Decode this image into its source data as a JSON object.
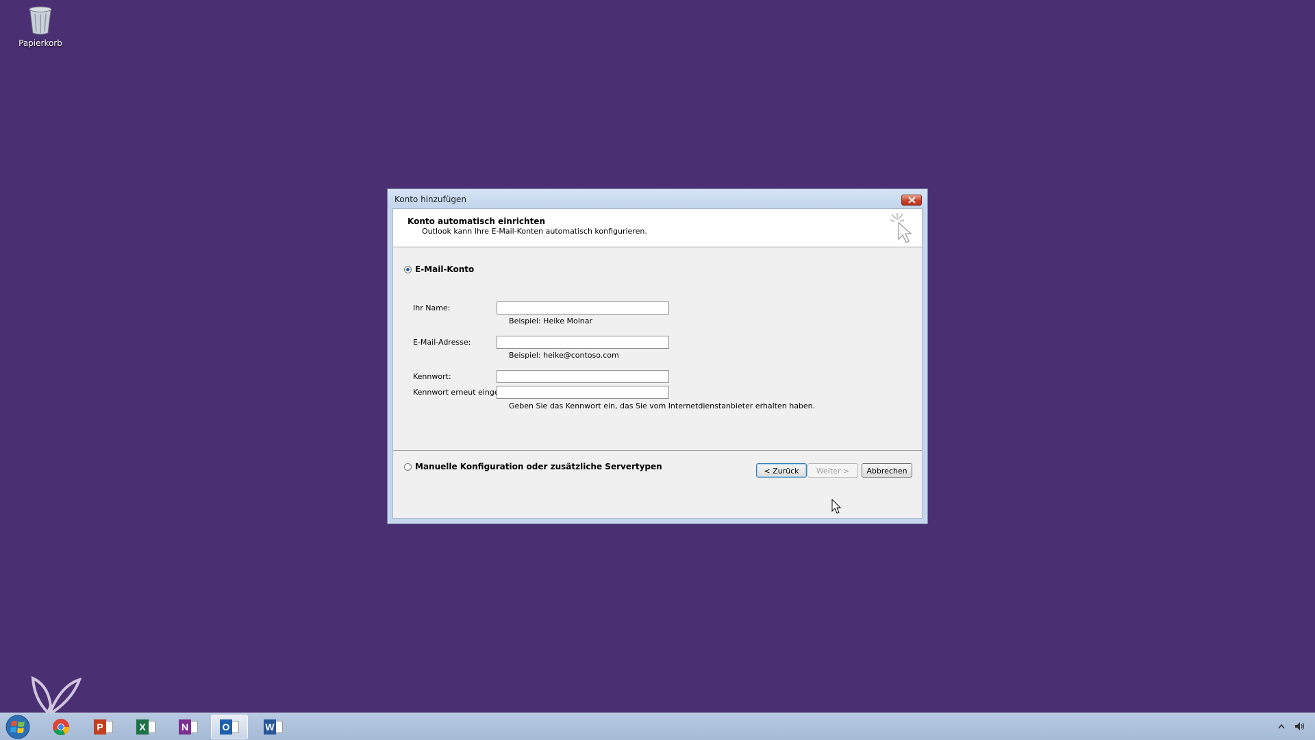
{
  "desktop": {
    "recycle_bin_label": "Papierkorb"
  },
  "dialog": {
    "window_title": "Konto hinzufügen",
    "header_title": "Konto automatisch einrichten",
    "header_subtitle": "Outlook kann Ihre E-Mail-Konten automatisch konfigurieren.",
    "option_email": {
      "label": "E-Mail-Konto",
      "selected": true
    },
    "fields": {
      "name": {
        "label": "Ihr Name:",
        "value": "",
        "hint": "Beispiel: Heike Molnar"
      },
      "email": {
        "label": "E-Mail-Adresse:",
        "value": "",
        "hint": "Beispiel: heike@contoso.com"
      },
      "password": {
        "label": "Kennwort:",
        "value": ""
      },
      "password_repeat": {
        "label": "Kennwort erneut eingeben:",
        "value": "",
        "hint": "Geben Sie das Kennwort ein, das Sie vom Internetdienstanbieter erhalten haben."
      }
    },
    "option_manual": {
      "label": "Manuelle Konfiguration oder zusätzliche Servertypen",
      "selected": false
    },
    "buttons": {
      "back": "< Zurück",
      "next": "Weiter >",
      "cancel": "Abbrechen"
    }
  },
  "taskbar": {
    "apps": [
      {
        "name": "chrome-icon"
      },
      {
        "name": "powerpoint-icon",
        "letter": "P",
        "color": "#c0401f"
      },
      {
        "name": "excel-icon",
        "letter": "X",
        "color": "#1e7145"
      },
      {
        "name": "onenote-icon",
        "letter": "N",
        "color": "#7b2f8f"
      },
      {
        "name": "outlook-icon",
        "letter": "O",
        "color": "#1f5fb0",
        "active": true
      },
      {
        "name": "word-icon",
        "letter": "W",
        "color": "#2a5599"
      }
    ]
  },
  "colors": {
    "desktop_background": "#4b2f73",
    "taskbar": "#b0c3dd"
  }
}
